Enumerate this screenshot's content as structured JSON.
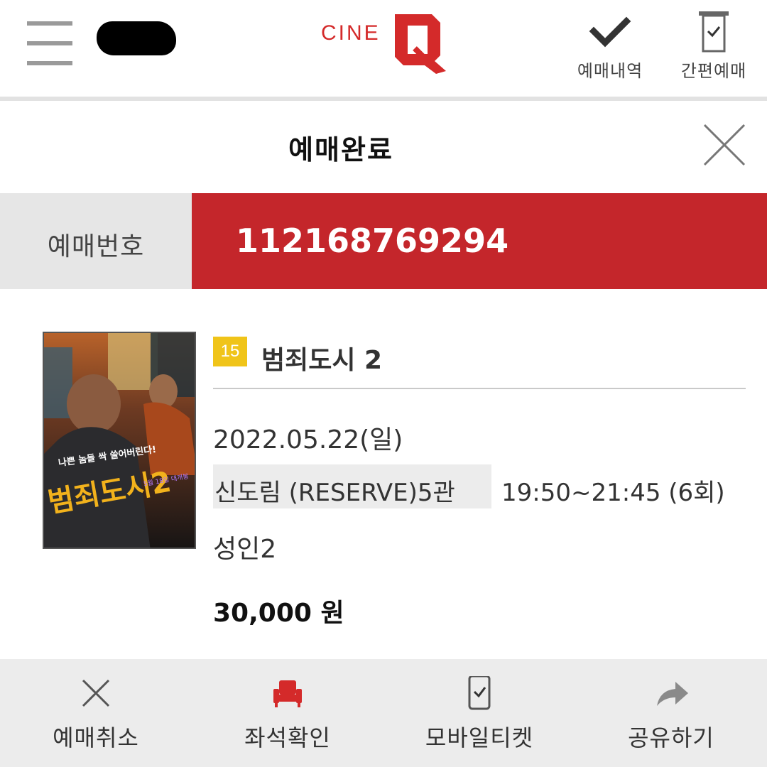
{
  "header": {
    "logo_text": "CINE",
    "logo_letter": "Q",
    "actions": [
      {
        "label": "예매내역",
        "icon": "checkmark-icon"
      },
      {
        "label": "간편예매",
        "icon": "receipt-check-icon"
      }
    ]
  },
  "page": {
    "title": "예매완료"
  },
  "booking": {
    "label": "예매번호",
    "number": "112168769294"
  },
  "movie": {
    "rating": "15",
    "title": "범죄도시 2",
    "date": "2022.05.22(일)",
    "theater": "신도림 (RESERVE)5관",
    "time": "19:50~21:45 (6회)",
    "people": "성인2",
    "price": "30,000 원",
    "poster": {
      "tagline": "나쁜 놈들 싹 쓸어버린다!",
      "title": "범죄도시2",
      "release": "5월 18일 대개봉"
    }
  },
  "bottom_actions": [
    {
      "label": "예매취소",
      "icon": "close-icon"
    },
    {
      "label": "좌석확인",
      "icon": "seat-icon"
    },
    {
      "label": "모바일티켓",
      "icon": "mobile-ticket-icon"
    },
    {
      "label": "공유하기",
      "icon": "share-icon"
    }
  ],
  "colors": {
    "brand_red": "#c4262b",
    "rating_yellow": "#f0c419"
  }
}
